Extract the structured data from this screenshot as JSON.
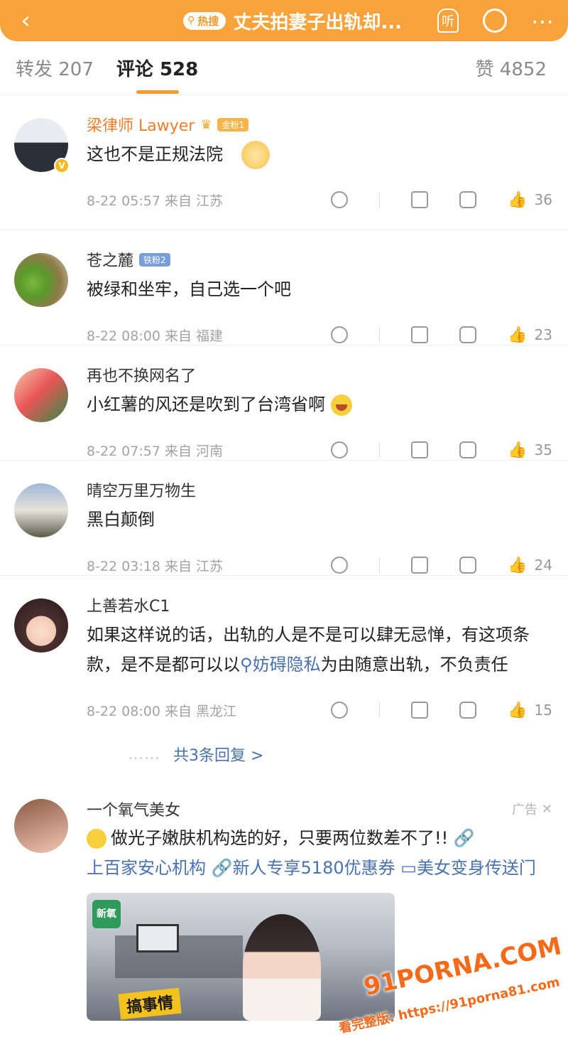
{
  "header": {
    "hot_tag": "热搜",
    "topic_title": "丈夫拍妻子出轨却...",
    "listen_label": "听"
  },
  "tabs": [
    {
      "label": "转发 207"
    },
    {
      "label": "评论 528"
    },
    {
      "label": "赞 4852"
    }
  ],
  "comments": [
    {
      "username": "梁律师 Lawyer",
      "badge": "金粉1",
      "text": "这也不是正规法院",
      "time": "8-22 05:57 来自 江苏",
      "likes": "36"
    },
    {
      "username": "苍之麓",
      "badge": "铁粉2",
      "text": "被绿和坐牢，自己选一个吧",
      "time": "8-22 08:00 来自 福建",
      "likes": "23"
    },
    {
      "username": "再也不换网名了",
      "text": "小红薯的风还是吹到了台湾省啊",
      "time": "8-22 07:57 来自 河南",
      "likes": "35"
    },
    {
      "username": "晴空万里万物生",
      "text": "黑白颠倒",
      "time": "8-22 03:18 来自 江苏",
      "likes": "24"
    },
    {
      "username": "上善若水C1",
      "text_before": "如果这样说的话，出轨的人是不是可以肆无忌惮，有这项条款，是不是都可以以",
      "text_link": "妨碍隐私",
      "text_after": "为由随意出轨，不负责任",
      "time": "8-22 08:00 来自 黑龙江",
      "likes": "15",
      "replies": "共3条回复 >"
    }
  ],
  "ad": {
    "username": "一个氧气美女",
    "ad_label": "广告",
    "text": "做光子嫩肤机构选的好，只要两位数差不了!!",
    "link1": "上百家安心机构",
    "link2": "新人专享5180优惠券",
    "link3": "美女变身传送门",
    "media_logo": "新氧",
    "media_caption": "搞事情"
  },
  "watermark": {
    "brand": "91PORNA.COM",
    "url": "看完整版: https://91porna81.com"
  }
}
